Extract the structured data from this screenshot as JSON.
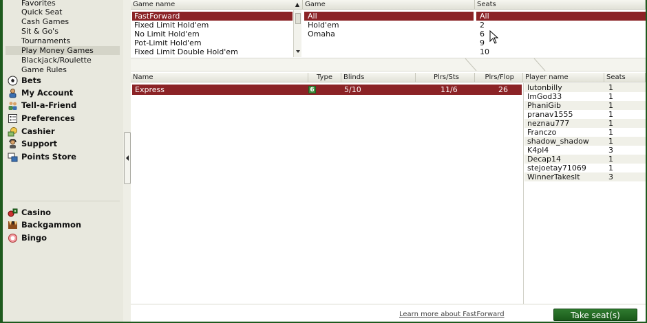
{
  "sidebar": {
    "sub_items": [
      "Favorites",
      "Quick Seat",
      "Cash Games",
      "Sit & Go's",
      "Tournaments",
      "Play Money Games",
      "Blackjack/Roulette",
      "Game Rules"
    ],
    "selected_sub": "Play Money Games",
    "main_items": [
      {
        "label": "Bets",
        "icon": "soccer-ball-icon"
      },
      {
        "label": "My Account",
        "icon": "person-icon"
      },
      {
        "label": "Tell-a-Friend",
        "icon": "people-icon"
      },
      {
        "label": "Preferences",
        "icon": "checklist-icon"
      },
      {
        "label": "Cashier",
        "icon": "cashier-icon"
      },
      {
        "label": "Support",
        "icon": "support-icon"
      },
      {
        "label": "Points Store",
        "icon": "points-store-icon"
      }
    ],
    "other_games": [
      {
        "label": "Casino",
        "icon": "casino-icon"
      },
      {
        "label": "Backgammon",
        "icon": "backgammon-icon"
      },
      {
        "label": "Bingo",
        "icon": "bingo-icon"
      }
    ]
  },
  "filters": {
    "game_name": {
      "header": "Game name",
      "items": [
        "FastForward",
        "Fixed Limit Hold'em",
        "No Limit Hold'em",
        "Pot-Limit Hold'em",
        "Fixed Limit Double Hold'em"
      ],
      "selected": "FastForward"
    },
    "game": {
      "header": "Game",
      "items": [
        "All",
        "Hold'em",
        "Omaha"
      ],
      "selected": "All"
    },
    "seats": {
      "header": "Seats",
      "items": [
        "All",
        "2",
        "6",
        "9",
        "10"
      ],
      "selected": "All"
    }
  },
  "tables": {
    "columns": [
      "Name",
      "Type",
      "Blinds",
      "Plrs/Sts",
      "Plrs/Flop"
    ],
    "rows": [
      {
        "name": "Express",
        "type": "6",
        "blinds": "5/10",
        "plrs_sts": "11/6",
        "plrs_flop": "26"
      }
    ]
  },
  "players": {
    "columns": [
      "Player name",
      "Seats"
    ],
    "rows": [
      {
        "name": "lutonbilly",
        "seats": "1"
      },
      {
        "name": "ImGod33",
        "seats": "1"
      },
      {
        "name": "PhaniGib",
        "seats": "1"
      },
      {
        "name": "pranav1555",
        "seats": "1"
      },
      {
        "name": "neznau777",
        "seats": "1"
      },
      {
        "name": "Franczo",
        "seats": "1"
      },
      {
        "name": "shadow_shadow",
        "seats": "1"
      },
      {
        "name": "K4pl4",
        "seats": "3"
      },
      {
        "name": "Decap14",
        "seats": "1"
      },
      {
        "name": "stejoetay71069",
        "seats": "1"
      },
      {
        "name": "WinnerTakesIt",
        "seats": "3"
      }
    ]
  },
  "footer": {
    "learn_more": "Learn more about FastForward",
    "take_seat": "Take seat(s)"
  },
  "colors": {
    "selection": "#8b2326",
    "accent_green": "#1e5a1e",
    "sidebar_bg": "#e8e8de"
  }
}
